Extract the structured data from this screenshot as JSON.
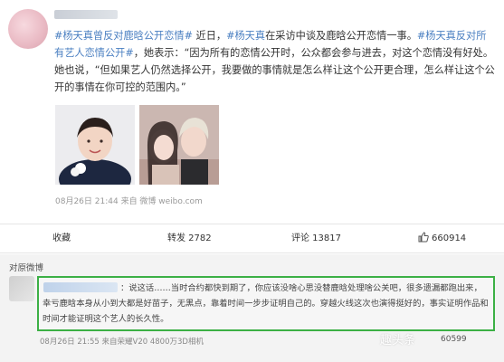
{
  "post": {
    "text_segments": [
      {
        "text": "#杨天真曾反对鹿晗公开恋情#",
        "highlight": true
      },
      {
        "text": " 近日，",
        "highlight": false
      },
      {
        "text": "#杨天真",
        "highlight": true
      },
      {
        "text": "在采访中谈及鹿晗公开恋情一事。",
        "highlight": false
      },
      {
        "text": "#杨天真反对所有艺人恋情公开#",
        "highlight": true
      },
      {
        "text": "，她表示：“因为所有的恋情公开时，公众都会参与进去，对这个恋情没有好处。她也说，“但如果艺人仍然选择公开，我要做的事情就是怎么样让这个公开更合理，怎么样让这个公开的事情在你可控的范围内。”",
        "highlight": false
      }
    ],
    "meta": "08月26日 21:44  来自 微博 weibo.com"
  },
  "actions": {
    "favorite": "收藏",
    "share": "转发 2782",
    "comment": "评论 13817",
    "like": "660914"
  },
  "comments": {
    "header": "对原微博",
    "top_comment": {
      "text": "：说这话……当时合约都快到期了，你应该没啥心思没替鹿晗处理啥公关吧，很多遗漏都跑出来，幸亏鹿晗本身从小到大都是好苗子，无黑点，靠着时间一步步证明自己的。穿越火线这次也演得挺好的，事实证明作品和时间才能证明这个艺人的长久性。",
      "meta": "08月26日 21:55  来自荣耀V20 4800万3D相机",
      "likes": "60599"
    }
  },
  "watermark": "趣头条",
  "colors": {
    "link": "#4a7fc1",
    "highlight_border": "#3cb045"
  }
}
